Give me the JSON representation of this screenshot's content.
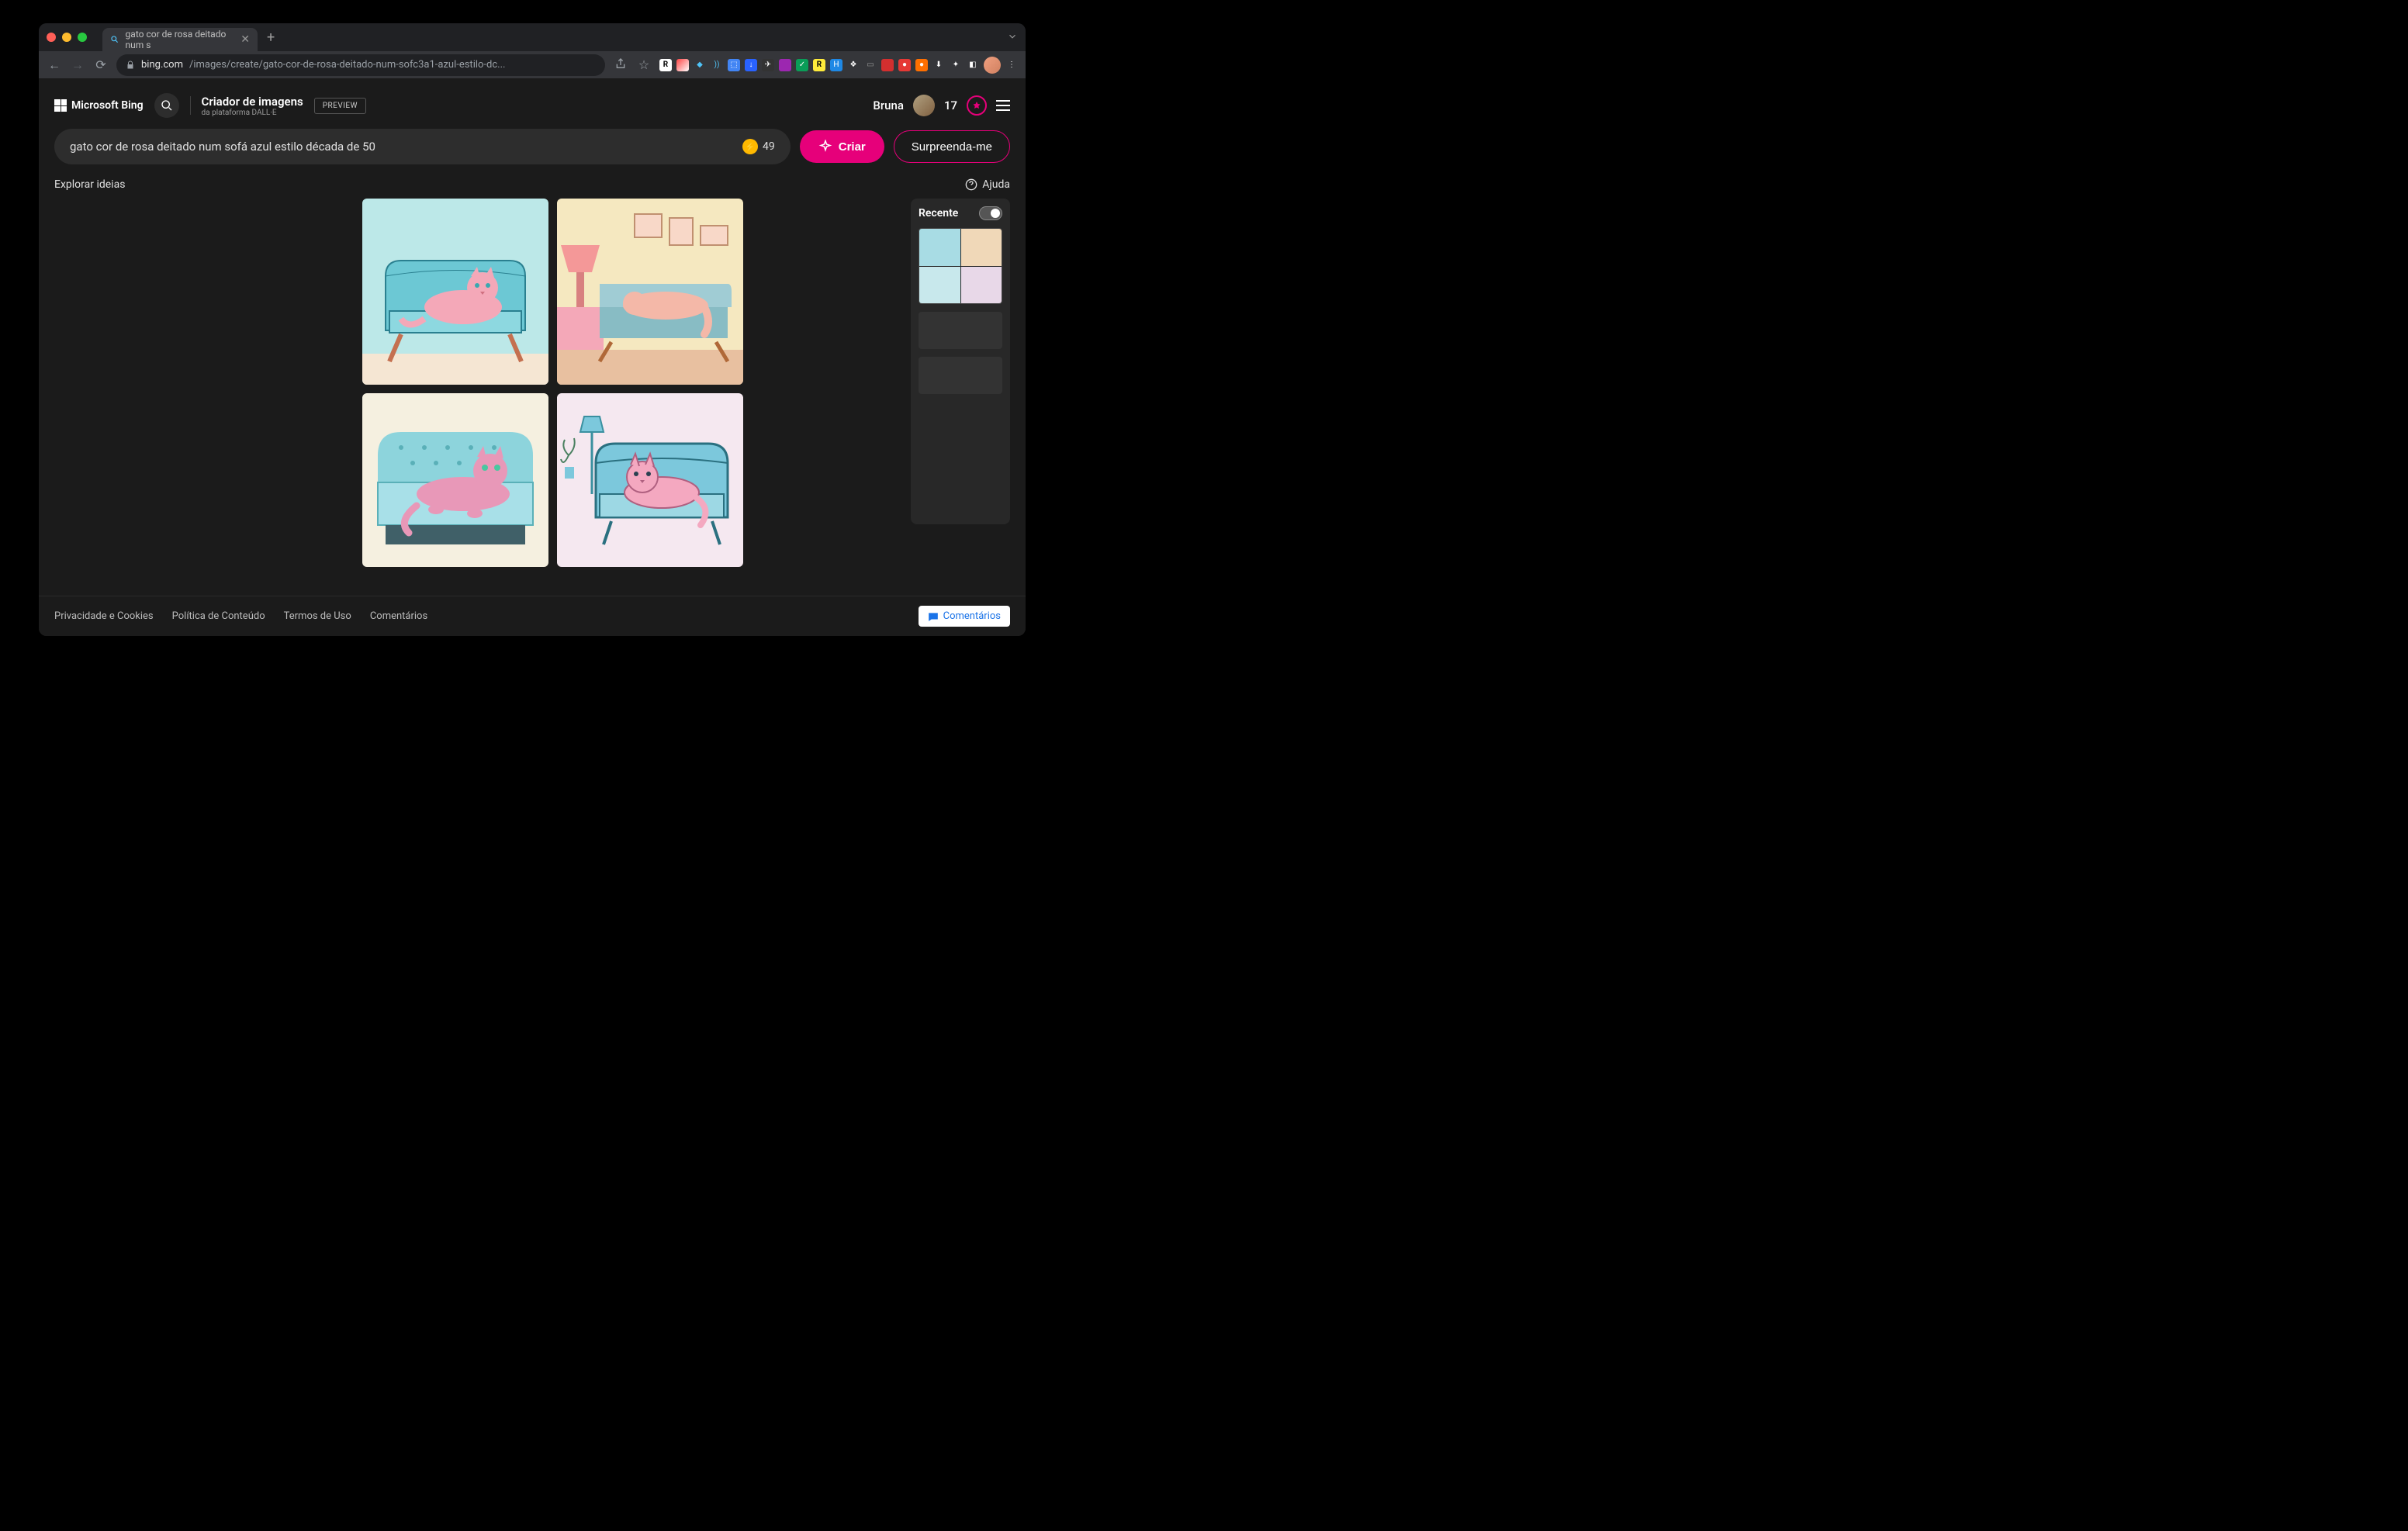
{
  "browser": {
    "tab_title": "gato cor de rosa deitado num s",
    "url_domain": "bing.com",
    "url_path": "/images/create/gato-cor-de-rosa-deitado-num-sofc3a1-azul-estilo-dc..."
  },
  "header": {
    "logo_text": "Microsoft Bing",
    "title": "Criador de imagens",
    "subtitle": "da plataforma DALL·E",
    "preview_badge": "PREVIEW",
    "username": "Bruna",
    "reward_points": "17"
  },
  "prompt": {
    "text": "gato cor de rosa deitado num sofá azul estilo década de 50",
    "boosts": "49",
    "create_label": "Criar",
    "surprise_label": "Surpreenda-me"
  },
  "toolbar": {
    "explore_label": "Explorar ideias",
    "help_label": "Ajuda"
  },
  "recent": {
    "title": "Recente"
  },
  "footer": {
    "links": [
      "Privacidade e Cookies",
      "Política de Conteúdo",
      "Termos de Uso",
      "Comentários"
    ],
    "feedback_button": "Comentários"
  }
}
